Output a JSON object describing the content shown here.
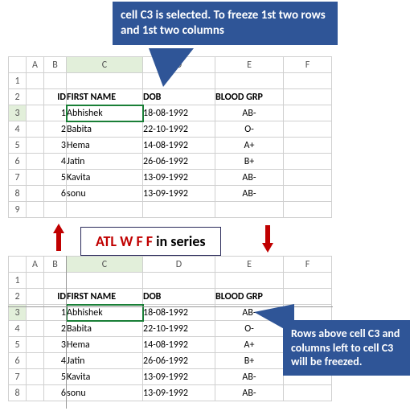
{
  "callout_top": "cell C3 is selected. To freeze 1st two rows and 1st two columns",
  "callout_bottom": "Rows above cell C3 and columns left to cell C3 will be freezed.",
  "banner_red": "ATL W F F ",
  "banner_black": "in series",
  "columns": [
    "A",
    "B",
    "C",
    "D",
    "E",
    "F"
  ],
  "row_nums": [
    "1",
    "2",
    "3",
    "4",
    "5",
    "6",
    "7",
    "8",
    "9"
  ],
  "headers": {
    "B": "ID",
    "C": "FIRST NAME",
    "D": "DOB",
    "E": "BLOOD GRP"
  },
  "rows": [
    {
      "id": "1",
      "name": "Abhishek",
      "dob": "18-08-1992",
      "bg": "AB-"
    },
    {
      "id": "2",
      "name": "Babita",
      "dob": "22-10-1992",
      "bg": "O-"
    },
    {
      "id": "3",
      "name": "Hema",
      "dob": "14-08-1992",
      "bg": "A+"
    },
    {
      "id": "4",
      "name": "Jatin",
      "dob": "26-06-1992",
      "bg": "B+"
    },
    {
      "id": "5",
      "name": "Kavita",
      "dob": "13-09-1992",
      "bg": "AB-"
    },
    {
      "id": "6",
      "name": "sonu",
      "dob": "13-09-1992",
      "bg": "AB-"
    }
  ],
  "chart_data": {
    "type": "table",
    "title": "",
    "columns": [
      "ID",
      "FIRST NAME",
      "DOB",
      "BLOOD GRP"
    ],
    "records": [
      [
        1,
        "Abhishek",
        "18-08-1992",
        "AB-"
      ],
      [
        2,
        "Babita",
        "22-10-1992",
        "O-"
      ],
      [
        3,
        "Hema",
        "14-08-1992",
        "A+"
      ],
      [
        4,
        "Jatin",
        "26-06-1992",
        "B+"
      ],
      [
        5,
        "Kavita",
        "13-09-1992",
        "AB-"
      ],
      [
        6,
        "sonu",
        "13-09-1992",
        "AB-"
      ]
    ],
    "selected_cell": "C3",
    "freeze_action": "Freeze first 2 rows and first 2 columns (ALT W F F)"
  }
}
